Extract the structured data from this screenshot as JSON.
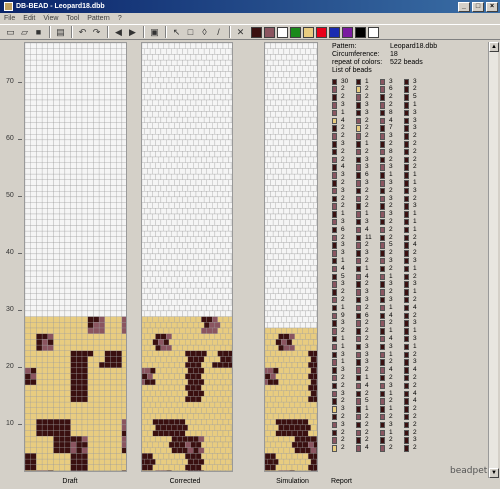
{
  "window": {
    "title": "DB-BEAD - Leopard18.dbb"
  },
  "menu": [
    "File",
    "Edit",
    "View",
    "Tool",
    "Pattern",
    "?"
  ],
  "toolbar": {
    "icons": [
      "new-icon",
      "open-icon",
      "save-icon",
      "print-icon",
      "undo-icon",
      "redo-icon",
      "prev-icon",
      "next-icon",
      "preview-icon",
      "pointer-icon",
      "select-icon",
      "fill-icon",
      "pipette-icon",
      "clear-icon"
    ]
  },
  "palette": [
    "#3a1010",
    "#8a5560",
    "#ffffff",
    "#1a8a1a",
    "#e8cc80",
    "#e8001a",
    "#1a2ab0",
    "#7a1aa0",
    "#000000",
    "#ffffff"
  ],
  "ruler": [
    "70",
    "60",
    "50",
    "40",
    "30",
    "20",
    "10"
  ],
  "panels": {
    "draft": "Draft",
    "corrected": "Corrected",
    "simulation": "Simulation",
    "report": "Report"
  },
  "info": {
    "pattern_label": "Pattern:",
    "pattern_value": "Leopard18.dbb",
    "circ_label": "Circumference:",
    "circ_value": "18",
    "repeat_label": "repeat of colors:",
    "repeat_value": "522 beads",
    "list_label": "List of beads"
  },
  "colors": {
    "dark": "#3a1010",
    "mauve": "#8a5560",
    "tan": "#e8cc80",
    "light": "#f5f5f5"
  },
  "bead_columns": [
    [
      [
        "d",
        "30"
      ],
      [
        "m",
        "2"
      ],
      [
        "d",
        "2"
      ],
      [
        "m",
        "3"
      ],
      [
        "m",
        "1"
      ],
      [
        "t",
        "4"
      ],
      [
        "d",
        "2"
      ],
      [
        "m",
        "2"
      ],
      [
        "d",
        "3"
      ],
      [
        "d",
        "2"
      ],
      [
        "m",
        "2"
      ],
      [
        "d",
        "4"
      ],
      [
        "m",
        "3"
      ],
      [
        "d",
        "2"
      ],
      [
        "m",
        "3"
      ],
      [
        "d",
        "2"
      ],
      [
        "m",
        "2"
      ],
      [
        "d",
        "1"
      ],
      [
        "m",
        "3"
      ],
      [
        "d",
        "6"
      ],
      [
        "m",
        "2"
      ],
      [
        "d",
        "3"
      ],
      [
        "m",
        "3"
      ],
      [
        "d",
        "1"
      ],
      [
        "m",
        "4"
      ],
      [
        "d",
        "5"
      ],
      [
        "m",
        "3"
      ],
      [
        "d",
        "2"
      ],
      [
        "m",
        "2"
      ],
      [
        "d",
        "1"
      ],
      [
        "m",
        "9"
      ],
      [
        "d",
        "3"
      ],
      [
        "m",
        "2"
      ],
      [
        "d",
        "1"
      ],
      [
        "m",
        "1"
      ],
      [
        "d",
        "3"
      ],
      [
        "m",
        "1"
      ],
      [
        "d",
        "3"
      ],
      [
        "m",
        "2"
      ],
      [
        "d",
        "2"
      ],
      [
        "m",
        "3"
      ],
      [
        "d",
        "2"
      ],
      [
        "t",
        "3"
      ],
      [
        "d",
        "2"
      ],
      [
        "m",
        "3"
      ],
      [
        "d",
        "2"
      ],
      [
        "m",
        "2"
      ],
      [
        "t",
        "2"
      ]
    ],
    [
      [
        "d",
        "1"
      ],
      [
        "t",
        "2"
      ],
      [
        "m",
        "2"
      ],
      [
        "d",
        "3"
      ],
      [
        "d",
        "3"
      ],
      [
        "m",
        "2"
      ],
      [
        "t",
        "2"
      ],
      [
        "m",
        "2"
      ],
      [
        "d",
        "1"
      ],
      [
        "m",
        "2"
      ],
      [
        "d",
        "3"
      ],
      [
        "m",
        "3"
      ],
      [
        "d",
        "6"
      ],
      [
        "m",
        "3"
      ],
      [
        "d",
        "2"
      ],
      [
        "m",
        "2"
      ],
      [
        "d",
        "2"
      ],
      [
        "m",
        "1"
      ],
      [
        "d",
        "3"
      ],
      [
        "m",
        "4"
      ],
      [
        "d",
        "11"
      ],
      [
        "m",
        "2"
      ],
      [
        "d",
        "3"
      ],
      [
        "m",
        "2"
      ],
      [
        "d",
        "1"
      ],
      [
        "m",
        "4"
      ],
      [
        "d",
        "2"
      ],
      [
        "m",
        "3"
      ],
      [
        "d",
        "3"
      ],
      [
        "m",
        "2"
      ],
      [
        "d",
        "6"
      ],
      [
        "m",
        "2"
      ],
      [
        "d",
        "2"
      ],
      [
        "m",
        "2"
      ],
      [
        "d",
        "3"
      ],
      [
        "m",
        "3"
      ],
      [
        "d",
        "3"
      ],
      [
        "m",
        "2"
      ],
      [
        "d",
        "1"
      ],
      [
        "m",
        "4"
      ],
      [
        "d",
        "2"
      ],
      [
        "m",
        "5"
      ],
      [
        "d",
        "1"
      ],
      [
        "m",
        "2"
      ],
      [
        "d",
        "2"
      ],
      [
        "m",
        "2"
      ],
      [
        "d",
        "2"
      ],
      [
        "m",
        "4"
      ]
    ],
    [
      [
        "m",
        "3"
      ],
      [
        "m",
        "6"
      ],
      [
        "d",
        "2"
      ],
      [
        "m",
        "2"
      ],
      [
        "d",
        "8"
      ],
      [
        "m",
        "4"
      ],
      [
        "d",
        "7"
      ],
      [
        "m",
        "3"
      ],
      [
        "d",
        "2"
      ],
      [
        "m",
        "8"
      ],
      [
        "d",
        "2"
      ],
      [
        "m",
        "3"
      ],
      [
        "d",
        "1"
      ],
      [
        "m",
        "3"
      ],
      [
        "d",
        "2"
      ],
      [
        "m",
        "3"
      ],
      [
        "d",
        "2"
      ],
      [
        "m",
        "3"
      ],
      [
        "d",
        "2"
      ],
      [
        "m",
        "2"
      ],
      [
        "d",
        "2"
      ],
      [
        "m",
        "5"
      ],
      [
        "d",
        "2"
      ],
      [
        "m",
        "3"
      ],
      [
        "d",
        "2"
      ],
      [
        "m",
        "1"
      ],
      [
        "d",
        "3"
      ],
      [
        "m",
        "2"
      ],
      [
        "d",
        "3"
      ],
      [
        "m",
        "1"
      ],
      [
        "d",
        "4"
      ],
      [
        "m",
        "2"
      ],
      [
        "d",
        "1"
      ],
      [
        "m",
        "4"
      ],
      [
        "d",
        "3"
      ],
      [
        "m",
        "1"
      ],
      [
        "d",
        "2"
      ],
      [
        "m",
        "4"
      ],
      [
        "d",
        "2"
      ],
      [
        "m",
        "3"
      ],
      [
        "d",
        "1"
      ],
      [
        "m",
        "2"
      ],
      [
        "d",
        "1"
      ],
      [
        "m",
        "2"
      ],
      [
        "d",
        "3"
      ],
      [
        "m",
        "1"
      ],
      [
        "d",
        "2"
      ],
      [
        "m",
        "2"
      ]
    ],
    [
      [
        "d",
        "3"
      ],
      [
        "d",
        "2"
      ],
      [
        "d",
        "5"
      ],
      [
        "d",
        "1"
      ],
      [
        "d",
        "3"
      ],
      [
        "d",
        "3"
      ],
      [
        "d",
        "3"
      ],
      [
        "d",
        "2"
      ],
      [
        "d",
        "2"
      ],
      [
        "d",
        "2"
      ],
      [
        "d",
        "2"
      ],
      [
        "d",
        "2"
      ],
      [
        "d",
        "1"
      ],
      [
        "d",
        "1"
      ],
      [
        "d",
        "3"
      ],
      [
        "d",
        "2"
      ],
      [
        "d",
        "3"
      ],
      [
        "d",
        "1"
      ],
      [
        "d",
        "1"
      ],
      [
        "d",
        "1"
      ],
      [
        "d",
        "2"
      ],
      [
        "d",
        "4"
      ],
      [
        "d",
        "2"
      ],
      [
        "d",
        "3"
      ],
      [
        "d",
        "1"
      ],
      [
        "d",
        "2"
      ],
      [
        "d",
        "3"
      ],
      [
        "d",
        "1"
      ],
      [
        "d",
        "2"
      ],
      [
        "d",
        "4"
      ],
      [
        "d",
        "2"
      ],
      [
        "d",
        "3"
      ],
      [
        "d",
        "1"
      ],
      [
        "d",
        "3"
      ],
      [
        "d",
        "1"
      ],
      [
        "d",
        "2"
      ],
      [
        "d",
        "3"
      ],
      [
        "d",
        "4"
      ],
      [
        "d",
        "2"
      ],
      [
        "d",
        "2"
      ],
      [
        "d",
        "4"
      ],
      [
        "d",
        "4"
      ],
      [
        "d",
        "2"
      ],
      [
        "d",
        "2"
      ],
      [
        "d",
        "2"
      ],
      [
        "d",
        "2"
      ],
      [
        "d",
        "3"
      ],
      [
        "d",
        "2"
      ]
    ]
  ],
  "logo": "beadpet"
}
